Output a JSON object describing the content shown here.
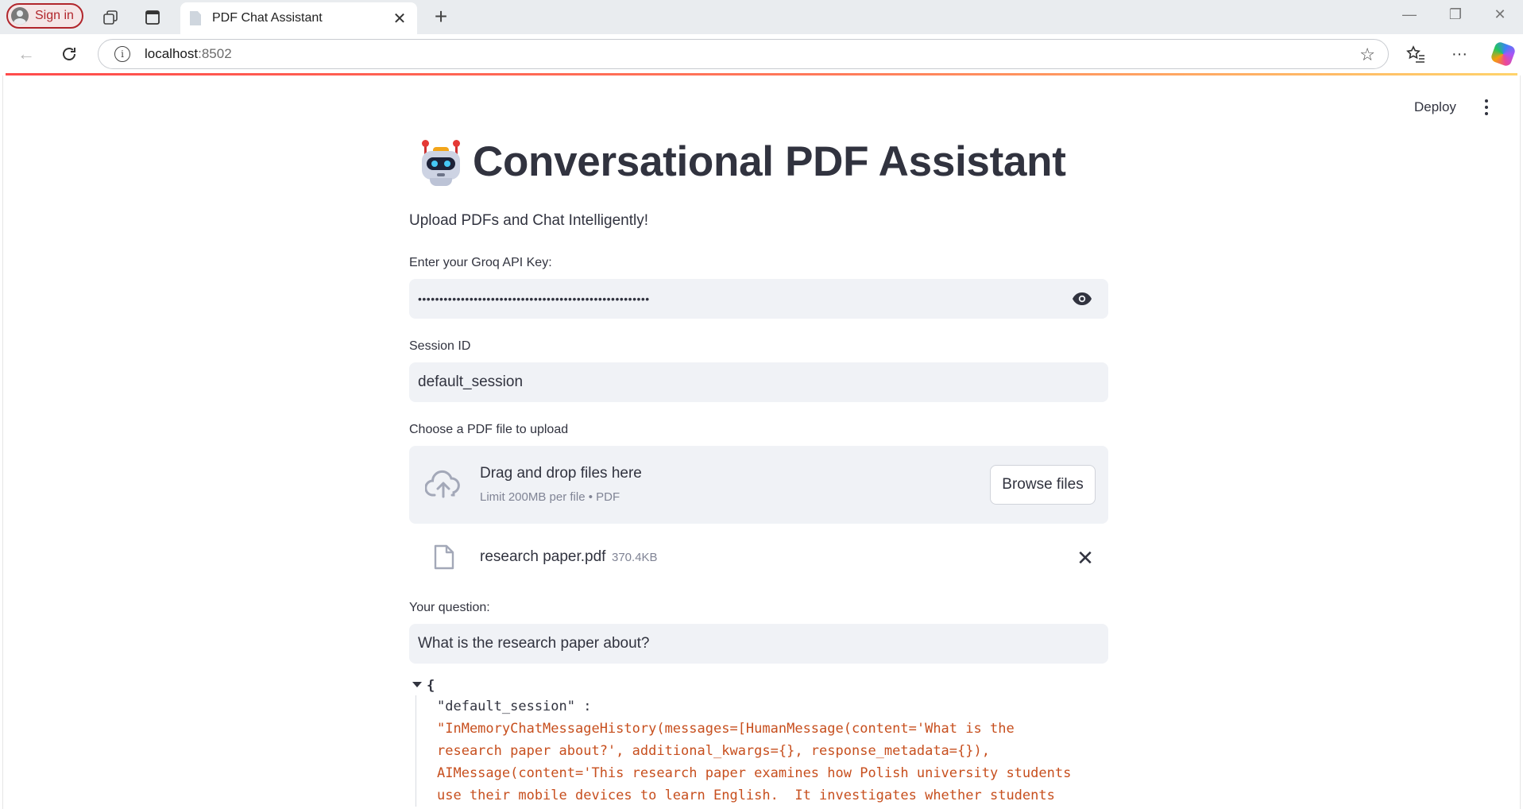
{
  "browser": {
    "sign_in_label": "Sign in",
    "tab_title": "PDF Chat Assistant",
    "url_host": "localhost",
    "url_port": ":8502"
  },
  "header": {
    "deploy_label": "Deploy"
  },
  "app": {
    "title": "Conversational PDF Assistant",
    "subtitle": "Upload PDFs and Chat Intelligently!",
    "api_key": {
      "label": "Enter your Groq API Key:",
      "masked_value": "••••••••••••••••••••••••••••••••••••••••••••••••••••••"
    },
    "session": {
      "label": "Session ID",
      "value": "default_session"
    },
    "uploader": {
      "label": "Choose a PDF file to upload",
      "drag_text": "Drag and drop files here",
      "limit_text": "Limit 200MB per file • PDF",
      "browse_label": "Browse files"
    },
    "file": {
      "name": "research paper.pdf",
      "size": "370.4KB"
    },
    "question": {
      "label": "Your question:",
      "value": "What is the research paper about?"
    },
    "json_view": {
      "open_brace": "{",
      "key": "\"default_session\" :",
      "value_lines": [
        "\"InMemoryChatMessageHistory(messages=[HumanMessage(content='What is the",
        "research paper about?', additional_kwargs={}, response_metadata={}),",
        "AIMessage(content='This research paper examines how Polish university students",
        "use their mobile devices to learn English.  It investigates whether students"
      ]
    }
  }
}
